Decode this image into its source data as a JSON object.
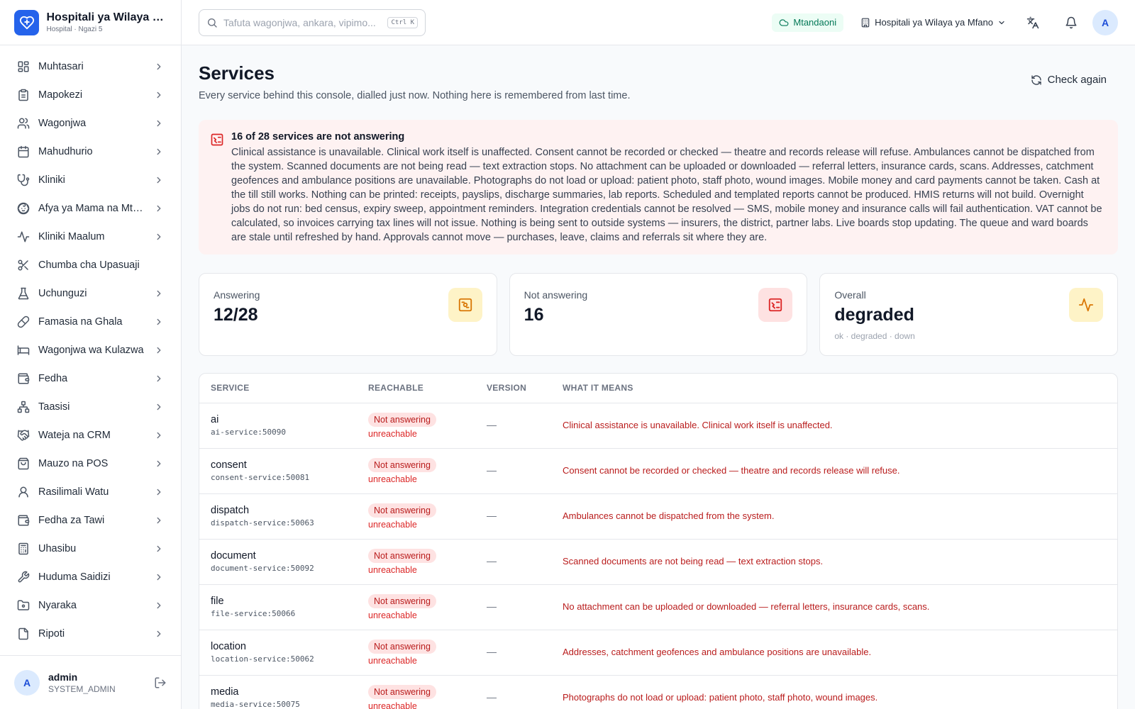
{
  "brand": {
    "name": "Hospitali ya Wilaya ya Mfano",
    "subtitle": "Hospital · Ngazi 5"
  },
  "search": {
    "placeholder": "Tafuta wagonjwa, ankara, vipimo...",
    "shortcut": "Ctrl K"
  },
  "topbar": {
    "status": "Mtandaoni",
    "facility": "Hospitali ya Wilaya ya Mfano",
    "avatar": "A"
  },
  "nav": [
    {
      "label": "Muhtasari",
      "icon": "dashboard-icon",
      "chevron": true
    },
    {
      "label": "Mapokezi",
      "icon": "clipboard-icon",
      "chevron": true
    },
    {
      "label": "Wagonjwa",
      "icon": "users-icon",
      "chevron": true
    },
    {
      "label": "Mahudhurio",
      "icon": "calendar-icon",
      "chevron": true
    },
    {
      "label": "Kliniki",
      "icon": "stethoscope-icon",
      "chevron": true
    },
    {
      "label": "Afya ya Mama na Mtoto",
      "icon": "baby-icon",
      "chevron": true
    },
    {
      "label": "Kliniki Maalum",
      "icon": "activity-icon",
      "chevron": true
    },
    {
      "label": "Chumba cha Upasuaji",
      "icon": "scissors-icon",
      "chevron": false
    },
    {
      "label": "Uchunguzi",
      "icon": "flask-icon",
      "chevron": true
    },
    {
      "label": "Famasia na Ghala",
      "icon": "pill-icon",
      "chevron": true
    },
    {
      "label": "Wagonjwa wa Kulazwa",
      "icon": "bed-icon",
      "chevron": true
    },
    {
      "label": "Fedha",
      "icon": "wallet-icon",
      "chevron": true
    },
    {
      "label": "Taasisi",
      "icon": "network-icon",
      "chevron": true
    },
    {
      "label": "Wateja na CRM",
      "icon": "handshake-icon",
      "chevron": true
    },
    {
      "label": "Mauzo na POS",
      "icon": "shopping-bag-icon",
      "chevron": true
    },
    {
      "label": "Rasilimali Watu",
      "icon": "user-icon",
      "chevron": true
    },
    {
      "label": "Fedha za Tawi",
      "icon": "wallet-icon",
      "chevron": true
    },
    {
      "label": "Uhasibu",
      "icon": "calculator-icon",
      "chevron": true
    },
    {
      "label": "Huduma Saidizi",
      "icon": "wrench-icon",
      "chevron": true
    },
    {
      "label": "Nyaraka",
      "icon": "folder-icon",
      "chevron": true
    },
    {
      "label": "Ripoti",
      "icon": "file-icon",
      "chevron": true
    }
  ],
  "user": {
    "initial": "A",
    "name": "admin",
    "role": "SYSTEM_ADMIN"
  },
  "page": {
    "title": "Services",
    "subtitle": "Every service behind this console, dialled just now. Nothing here is remembered from last time.",
    "check_again": "Check again"
  },
  "alert": {
    "title": "16 of 28 services are not answering",
    "text": "Clinical assistance is unavailable. Clinical work itself is unaffected. Consent cannot be recorded or checked — theatre and records release will refuse. Ambulances cannot be dispatched from the system. Scanned documents are not being read — text extraction stops. No attachment can be uploaded or downloaded — referral letters, insurance cards, scans. Addresses, catchment geofences and ambulance positions are unavailable. Photographs do not load or upload: patient photo, staff photo, wound images. Mobile money and card payments cannot be taken. Cash at the till still works. Nothing can be printed: receipts, payslips, discharge summaries, lab reports. Scheduled and templated reports cannot be produced. HMIS returns will not build. Overnight jobs do not run: bed census, expiry sweep, appointment reminders. Integration credentials cannot be resolved — SMS, mobile money and insurance calls will fail authentication. VAT cannot be calculated, so invoices carrying tax lines will not issue. Nothing is being sent to outside systems — insurers, the district, partner labs. Live boards stop updating. The queue and ward boards are stale until refreshed by hand. Approvals cannot move — purchases, leave, claims and referrals sit where they are."
  },
  "stats": {
    "answering": {
      "label": "Answering",
      "value": "12/28",
      "color": "#d97706"
    },
    "not_answering": {
      "label": "Not answering",
      "value": "16",
      "color": "#dc2626"
    },
    "overall": {
      "label": "Overall",
      "value": "degraded",
      "hint": "ok · degraded · down",
      "color": "#d97706"
    }
  },
  "table": {
    "headers": {
      "service": "SERVICE",
      "reachable": "REACHABLE",
      "version": "VERSION",
      "meaning": "WHAT IT MEANS"
    },
    "rows": [
      {
        "name": "ai",
        "host": "ai-service:50090",
        "status": "Not answering",
        "detail": "unreachable",
        "version": "—",
        "meaning": "Clinical assistance is unavailable. Clinical work itself is unaffected."
      },
      {
        "name": "consent",
        "host": "consent-service:50081",
        "status": "Not answering",
        "detail": "unreachable",
        "version": "—",
        "meaning": "Consent cannot be recorded or checked — theatre and records release will refuse."
      },
      {
        "name": "dispatch",
        "host": "dispatch-service:50063",
        "status": "Not answering",
        "detail": "unreachable",
        "version": "—",
        "meaning": "Ambulances cannot be dispatched from the system."
      },
      {
        "name": "document",
        "host": "document-service:50092",
        "status": "Not answering",
        "detail": "unreachable",
        "version": "—",
        "meaning": "Scanned documents are not being read — text extraction stops."
      },
      {
        "name": "file",
        "host": "file-service:50066",
        "status": "Not answering",
        "detail": "unreachable",
        "version": "—",
        "meaning": "No attachment can be uploaded or downloaded — referral letters, insurance cards, scans."
      },
      {
        "name": "location",
        "host": "location-service:50062",
        "status": "Not answering",
        "detail": "unreachable",
        "version": "—",
        "meaning": "Addresses, catchment geofences and ambulance positions are unavailable."
      },
      {
        "name": "media",
        "host": "media-service:50075",
        "status": "Not answering",
        "detail": "unreachable",
        "version": "—",
        "meaning": "Photographs do not load or upload: patient photo, staff photo, wound images."
      }
    ]
  }
}
